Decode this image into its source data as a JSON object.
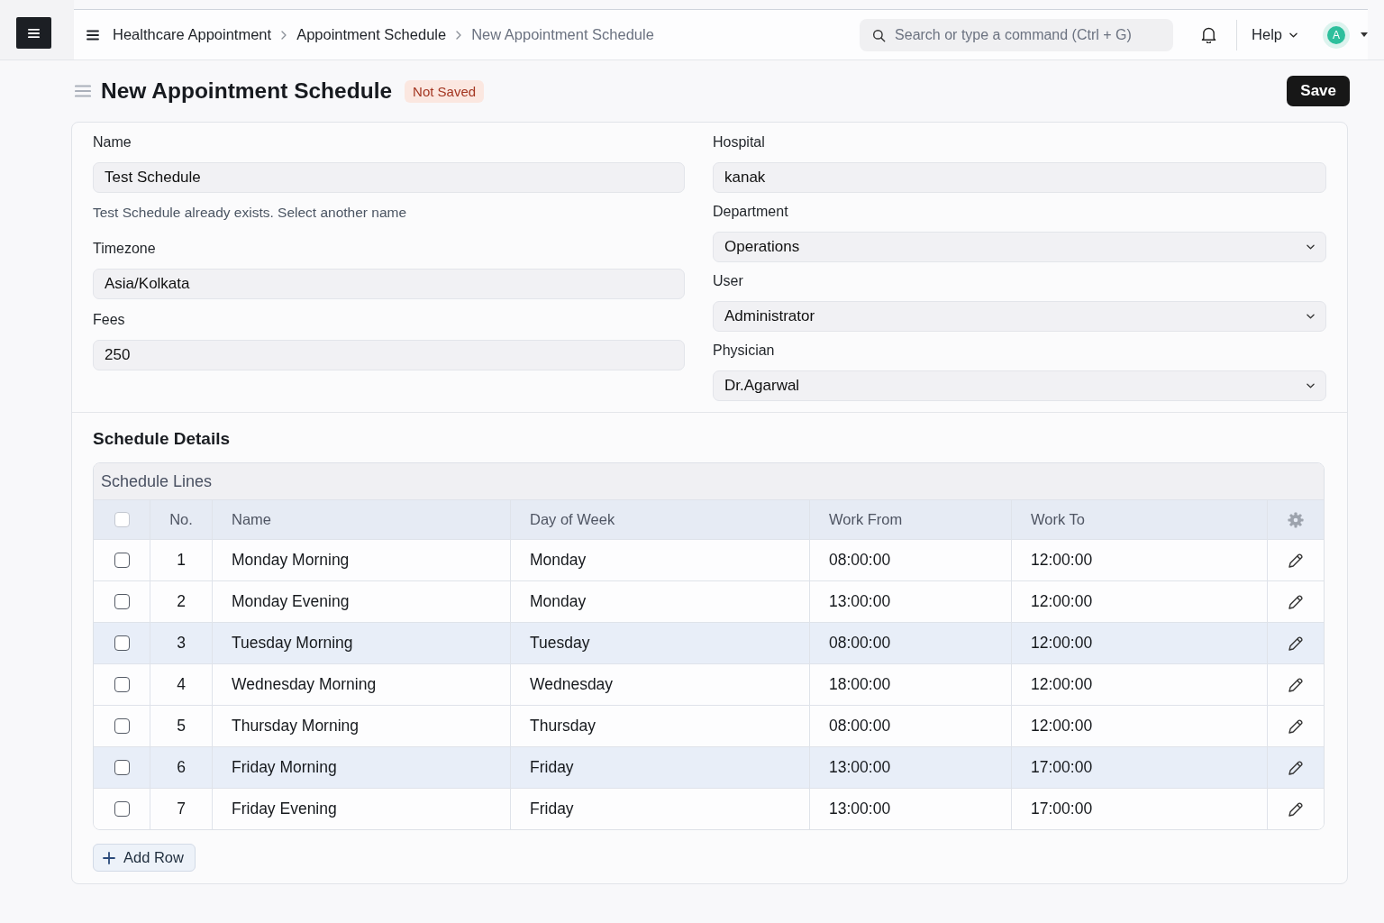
{
  "navbar": {
    "breadcrumbs": [
      {
        "label": "Healthcare Appointment",
        "current": false
      },
      {
        "label": "Appointment Schedule",
        "current": false
      },
      {
        "label": "New Appointment Schedule",
        "current": true
      }
    ],
    "search": {
      "placeholder": "Search or type a command (Ctrl + G)"
    },
    "help": "Help",
    "avatar": "A"
  },
  "page": {
    "title": "New Appointment Schedule",
    "status": "Not Saved",
    "save_button": "Save"
  },
  "form": {
    "left": [
      {
        "label": "Name",
        "kind": "text",
        "value": "Test Schedule",
        "error": "Test Schedule already exists. Select another name"
      },
      {
        "label": "Timezone",
        "kind": "text",
        "value": "Asia/Kolkata"
      },
      {
        "label": "Fees",
        "kind": "text",
        "value": "250"
      }
    ],
    "right": [
      {
        "label": "Hospital",
        "kind": "text",
        "value": "kanak"
      },
      {
        "label": "Department",
        "kind": "select",
        "value": "Operations"
      },
      {
        "label": "User",
        "kind": "select",
        "value": "Administrator"
      },
      {
        "label": "Physician",
        "kind": "select",
        "value": "Dr.Agarwal"
      }
    ]
  },
  "schedule_details": {
    "title": "Schedule Details",
    "table": {
      "title": "Schedule Lines",
      "all_checked": false,
      "columns": [
        "No.",
        "Name",
        "Day of Week",
        "Work From",
        "Work To"
      ],
      "rows": [
        {
          "no": "1",
          "name": "Monday Morning",
          "day": "Monday",
          "work_from": "08:00:00",
          "work_to": "12:00:00",
          "checked": false,
          "highlighted": false
        },
        {
          "no": "2",
          "name": "Monday Evening",
          "day": "Monday",
          "work_from": "13:00:00",
          "work_to": "12:00:00",
          "checked": false,
          "highlighted": false
        },
        {
          "no": "3",
          "name": "Tuesday Morning",
          "day": "Tuesday",
          "work_from": "08:00:00",
          "work_to": "12:00:00",
          "checked": false,
          "highlighted": true
        },
        {
          "no": "4",
          "name": "Wednesday Morning",
          "day": "Wednesday",
          "work_from": "18:00:00",
          "work_to": "12:00:00",
          "checked": false,
          "highlighted": false
        },
        {
          "no": "5",
          "name": "Thursday Morning",
          "day": "Thursday",
          "work_from": "08:00:00",
          "work_to": "12:00:00",
          "checked": false,
          "highlighted": false
        },
        {
          "no": "6",
          "name": "Friday Morning",
          "day": "Friday",
          "work_from": "13:00:00",
          "work_to": "17:00:00",
          "checked": false,
          "highlighted": true
        },
        {
          "no": "7",
          "name": "Friday Evening",
          "day": "Friday",
          "work_from": "13:00:00",
          "work_to": "17:00:00",
          "checked": false,
          "highlighted": false
        }
      ],
      "add_row": "Add Row"
    }
  }
}
